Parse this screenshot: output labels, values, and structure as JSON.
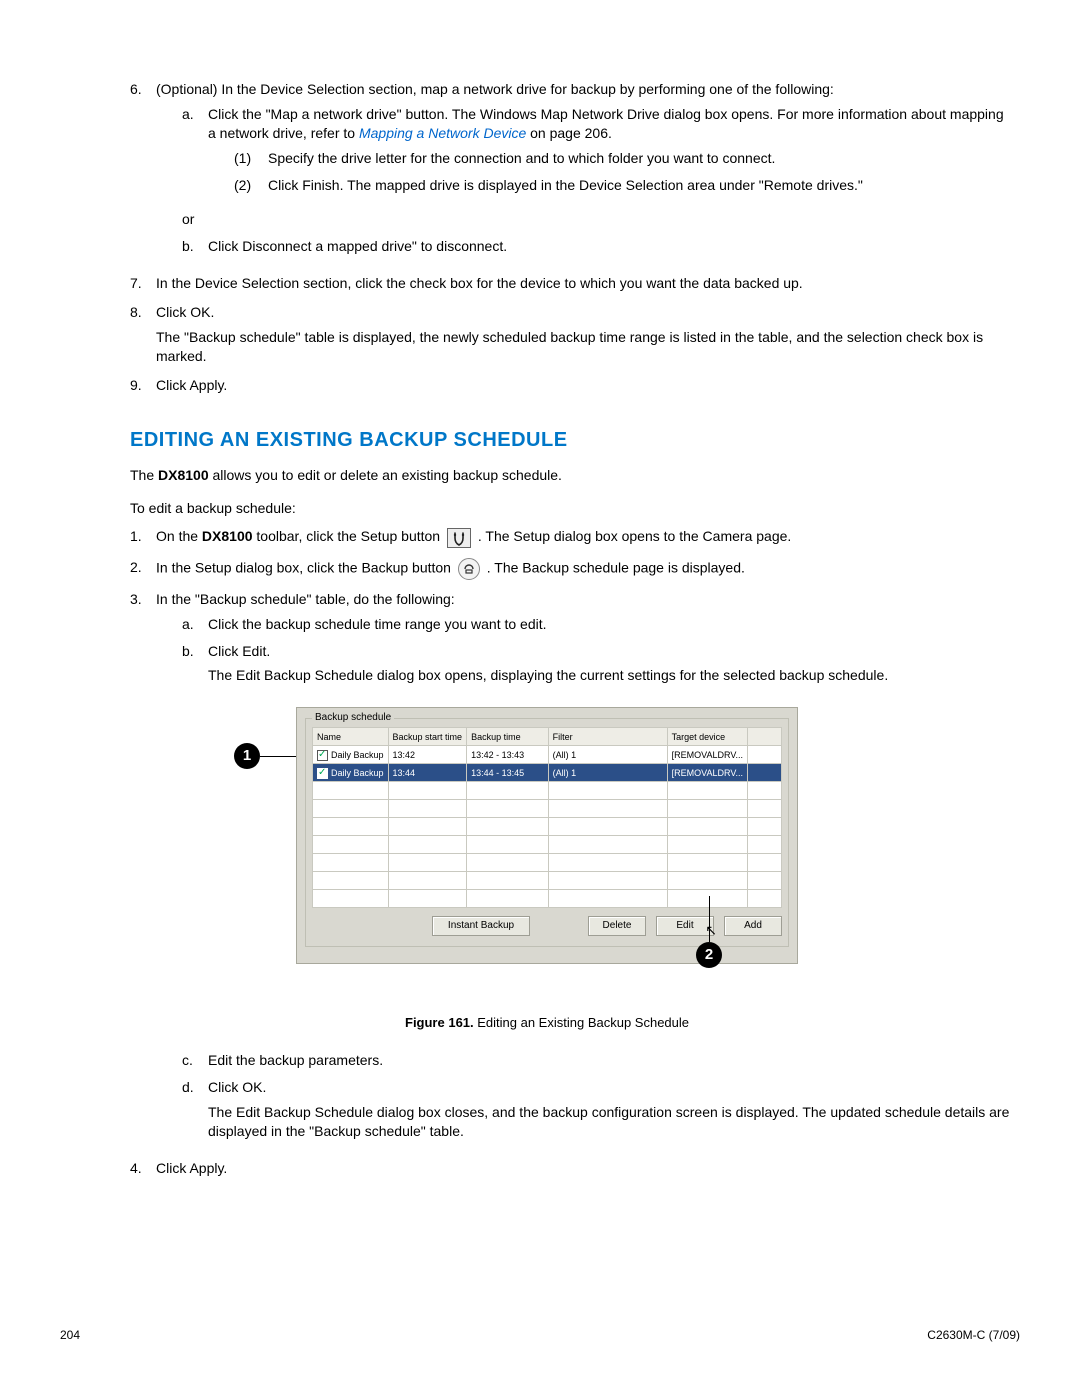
{
  "step6": {
    "num": "6.",
    "text": "(Optional) In the Device Selection section, map a network drive for backup by performing one of the following:",
    "a_mk": "a.",
    "a_pre": "Click the \"Map a network drive\" button. The Windows Map Network Drive dialog box opens. For more information about mapping a network drive, refer to ",
    "a_link": "Mapping a Network Device",
    "a_post": " on page 206.",
    "p1_mk": "(1)",
    "p1_txt": "Specify the drive letter for the connection and to which folder you want to connect.",
    "p2_mk": "(2)",
    "p2_txt": "Click Finish. The mapped drive is displayed in the Device Selection area under \"Remote drives.\"",
    "or": "or",
    "b_mk": "b.",
    "b_txt": "Click Disconnect a mapped drive\" to disconnect."
  },
  "step7": {
    "num": "7.",
    "text": "In the Device Selection section, click the check box for the device to which you want the data backed up."
  },
  "step8": {
    "num": "8.",
    "text": "Click OK.",
    "para": "The \"Backup schedule\" table is displayed, the newly scheduled backup time range is listed in the table, and the selection check box is marked."
  },
  "step9": {
    "num": "9.",
    "text": "Click Apply."
  },
  "heading": "EDITING AN EXISTING BACKUP SCHEDULE",
  "intro_pre": "The ",
  "intro_model": "DX8100",
  "intro_post": " allows you to edit or delete an existing backup schedule.",
  "lead": "To edit a backup schedule:",
  "edit1": {
    "num": "1.",
    "pre": "On the ",
    "model": "DX8100",
    "mid": " toolbar, click the Setup button ",
    "post": ". The Setup dialog box opens to the Camera page."
  },
  "edit2": {
    "num": "2.",
    "pre": "In the Setup dialog box, click the Backup button ",
    "post": ". The Backup schedule page is displayed."
  },
  "edit3": {
    "num": "3.",
    "text": "In the \"Backup schedule\" table, do the following:",
    "a_mk": "a.",
    "a_txt": "Click the backup schedule time range you want to edit.",
    "b_mk": "b.",
    "b_txt": "Click Edit.",
    "b_para": "The Edit Backup Schedule dialog box opens, displaying the current settings for the selected backup schedule.",
    "c_mk": "c.",
    "c_txt": "Edit the backup parameters.",
    "d_mk": "d.",
    "d_txt": "Click OK.",
    "d_para": "The Edit Backup Schedule dialog box closes, and the backup configuration screen is displayed. The updated schedule details are displayed in the \"Backup schedule\" table."
  },
  "edit4": {
    "num": "4.",
    "text": "Click Apply."
  },
  "figure": {
    "group_label": "Backup schedule",
    "headers": {
      "name": "Name",
      "start": "Backup start time",
      "btime": "Backup time",
      "filter": "Filter",
      "target": "Target device"
    },
    "rows": [
      {
        "name": "Daily Backup",
        "start": "13:42",
        "btime": "13:42 - 13:43",
        "filter": "(All) 1",
        "target": "[REMOVALDRV..."
      },
      {
        "name": "Daily Backup",
        "start": "13:44",
        "btime": "13:44 - 13:45",
        "filter": "(All) 1",
        "target": "[REMOVALDRV..."
      }
    ],
    "buttons": {
      "instant": "Instant Backup",
      "delete": "Delete",
      "edit": "Edit",
      "add": "Add"
    },
    "callout1": "1",
    "callout2": "2",
    "caption_pre": "Figure 161.",
    "caption_post": "  Editing an Existing Backup Schedule"
  },
  "footer": {
    "page": "204",
    "doc": "C2630M-C (7/09)"
  }
}
